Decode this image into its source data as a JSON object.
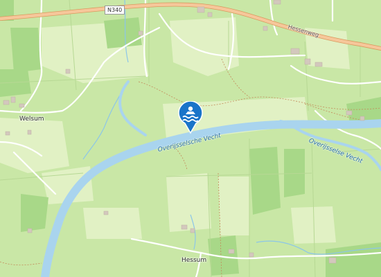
{
  "map": {
    "labels": {
      "road_shield": "N340",
      "road_name": "Hessenweg",
      "river_name_main": "Overijsselsche Vecht",
      "river_name_east": "Overijsselse Vecht",
      "town_west": "Welsum",
      "town_south": "Hessum"
    },
    "marker": {
      "icon": "swimming-icon",
      "color": "#1a74c9"
    },
    "colors": {
      "land": "#c9e7a6",
      "meadow": "#dff0c0",
      "forest": "#a9d88a",
      "water": "#a9d4ee",
      "road": "#f6c79a"
    }
  }
}
